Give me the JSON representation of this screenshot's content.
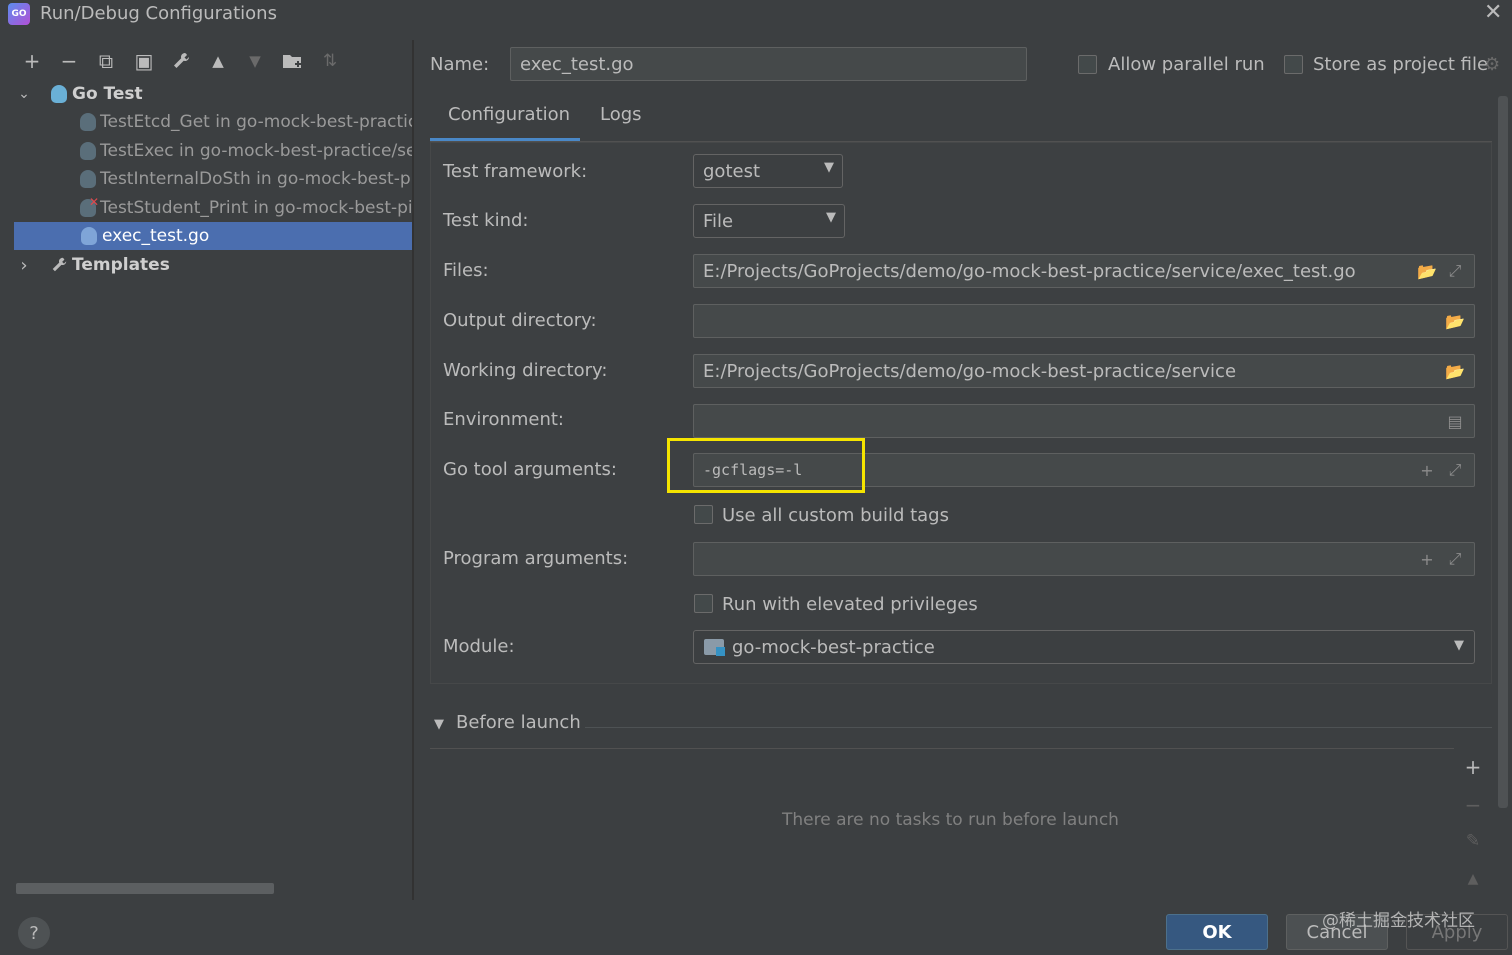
{
  "window": {
    "title": "Run/Debug Configurations",
    "logo_text": "GO",
    "close_glyph": "✕"
  },
  "toolbar": {
    "icons": [
      "add-icon",
      "remove-icon",
      "copy-icon",
      "save-icon",
      "wrench-icon",
      "move-up-icon",
      "move-down-icon",
      "folder-add-icon",
      "sort-icon"
    ],
    "glyphs": {
      "add": "+",
      "remove": "−",
      "copy": "⧉",
      "save": "▣",
      "wrench": "🔧",
      "up": "▲",
      "down": "▼",
      "folder": "📁",
      "sort": "⇅"
    }
  },
  "tree": {
    "go_test_label": "Go Test",
    "items": [
      "TestEtcd_Get in go-mock-best-practic",
      "TestExec in go-mock-best-practice/se",
      "TestInternalDoSth in go-mock-best-pi",
      "TestStudent_Print in go-mock-best-pi",
      "exec_test.go"
    ],
    "templates_label": "Templates",
    "expanded_glyph": "⌄",
    "collapsed_glyph": "›"
  },
  "header": {
    "name_label": "Name:",
    "name_value": "exec_test.go",
    "allow_parallel_label": "Allow parallel run",
    "store_project_label": "Store as project file"
  },
  "tabs": {
    "configuration": "Configuration",
    "logs": "Logs"
  },
  "config": {
    "test_framework_label": "Test framework:",
    "test_framework_value": "gotest",
    "test_kind_label": "Test kind:",
    "test_kind_value": "File",
    "files_label": "Files:",
    "files_value": "E:/Projects/GoProjects/demo/go-mock-best-practice/service/exec_test.go",
    "output_dir_label": "Output directory:",
    "output_dir_value": "",
    "working_dir_label": "Working directory:",
    "working_dir_value": "E:/Projects/GoProjects/demo/go-mock-best-practice/service",
    "environment_label": "Environment:",
    "environment_value": "",
    "go_tool_args_label": "Go tool arguments:",
    "go_tool_args_value": "-gcflags=-l",
    "use_custom_tags_label": "Use all custom build tags",
    "program_args_label": "Program arguments:",
    "program_args_value": "",
    "elevated_label": "Run with elevated privileges",
    "module_label": "Module:",
    "module_value": "go-mock-best-practice",
    "highlight_color": "#f5e400"
  },
  "before_launch": {
    "title": "Before launch",
    "toggle_glyph": "▼",
    "empty_text": "There are no tasks to run before launch"
  },
  "buttons": {
    "ok": "OK",
    "cancel": "Cancel",
    "apply": "Apply",
    "help": "?"
  },
  "watermark": "@稀土掘金技术社区",
  "colors": {
    "selection": "#4b6eaf",
    "accent": "#4a88c7",
    "ok_button": "#365880"
  }
}
